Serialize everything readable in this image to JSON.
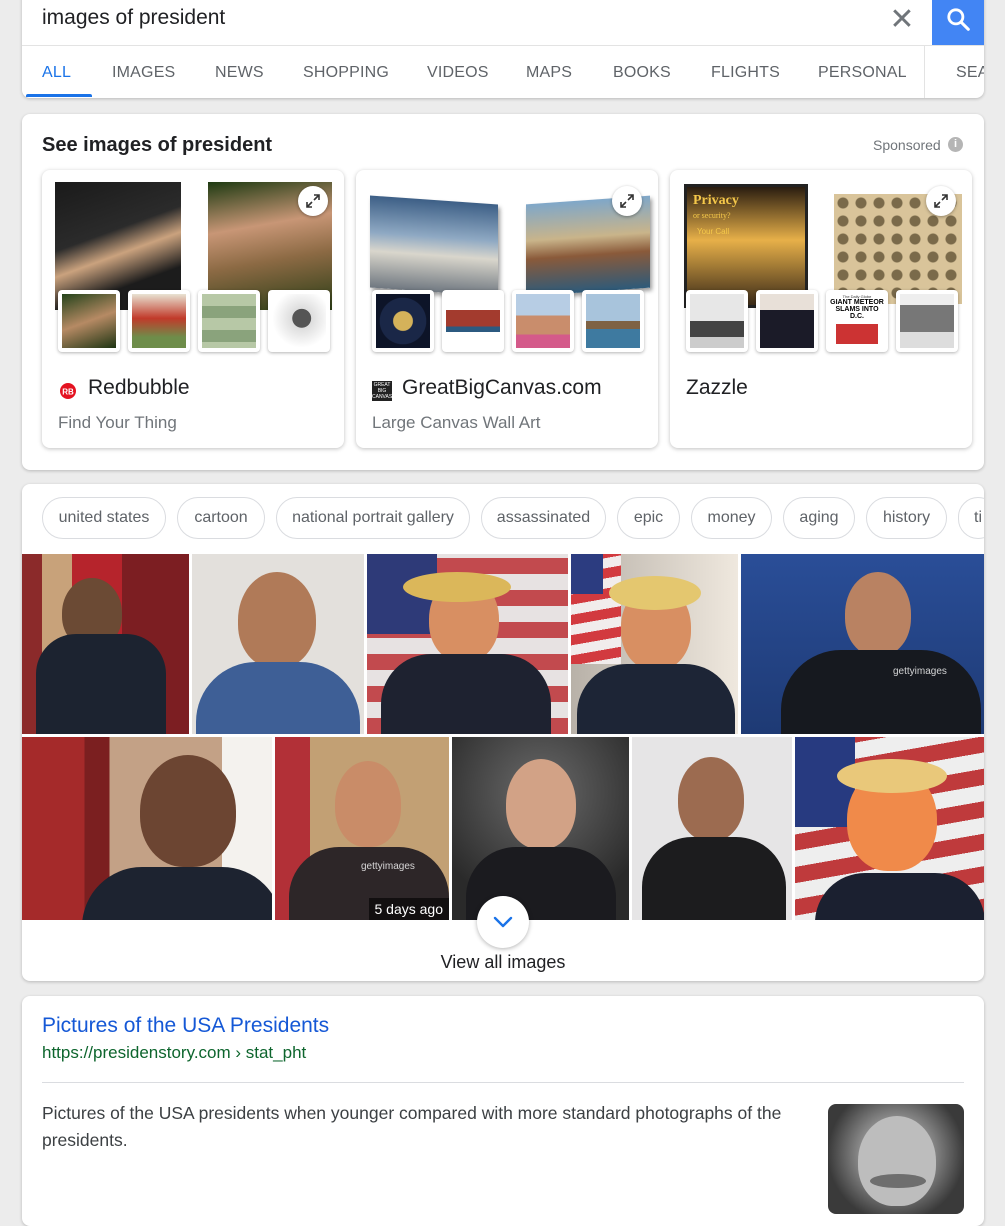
{
  "search": {
    "query": "images of president",
    "clear_icon": "close-icon",
    "search_icon": "search-icon"
  },
  "tabs": [
    {
      "label": "ALL",
      "active": true
    },
    {
      "label": "IMAGES"
    },
    {
      "label": "NEWS"
    },
    {
      "label": "SHOPPING"
    },
    {
      "label": "VIDEOS"
    },
    {
      "label": "MAPS"
    },
    {
      "label": "BOOKS"
    },
    {
      "label": "FLIGHTS"
    },
    {
      "label": "PERSONAL"
    },
    {
      "label": "SEA"
    }
  ],
  "shopping": {
    "title": "See images of president",
    "sponsored_label": "Sponsored",
    "merchants": [
      {
        "name": "Redbubble",
        "subtitle": "Find Your Thing",
        "logo": "redbubble-logo"
      },
      {
        "name": "GreatBigCanvas.com",
        "subtitle": "Large Canvas Wall Art",
        "logo": "greatbigcanvas-logo",
        "logo_text": "GREAT BIG CANVAS"
      },
      {
        "name": "Zazzle",
        "subtitle": ""
      }
    ],
    "product_text": {
      "privacy": "Privacy",
      "or_security": "or security?",
      "your_call": "Your Call",
      "daily_globe": "The Daily Globe",
      "meteor_headline": "GIANT METEOR SLAMS INTO D.C."
    }
  },
  "images": {
    "chips": [
      "united states",
      "cartoon",
      "national portrait gallery",
      "assassinated",
      "epic",
      "money",
      "aging",
      "history",
      "ti"
    ],
    "caption_recent": "5 days ago",
    "watermark": "gettyimages",
    "view_all_label": "View all images",
    "expand_icon": "chevron-down-icon"
  },
  "result": {
    "title": "Pictures of the USA Presidents",
    "url": "https://presidenstory.com › stat_pht",
    "snippet": "Pictures of the USA presidents when younger compared with more standard photographs of the presidents."
  },
  "colors": {
    "accent": "#1a73e8",
    "search_button": "#4285f4",
    "link": "#1558d6",
    "url_green": "#0d652d"
  }
}
